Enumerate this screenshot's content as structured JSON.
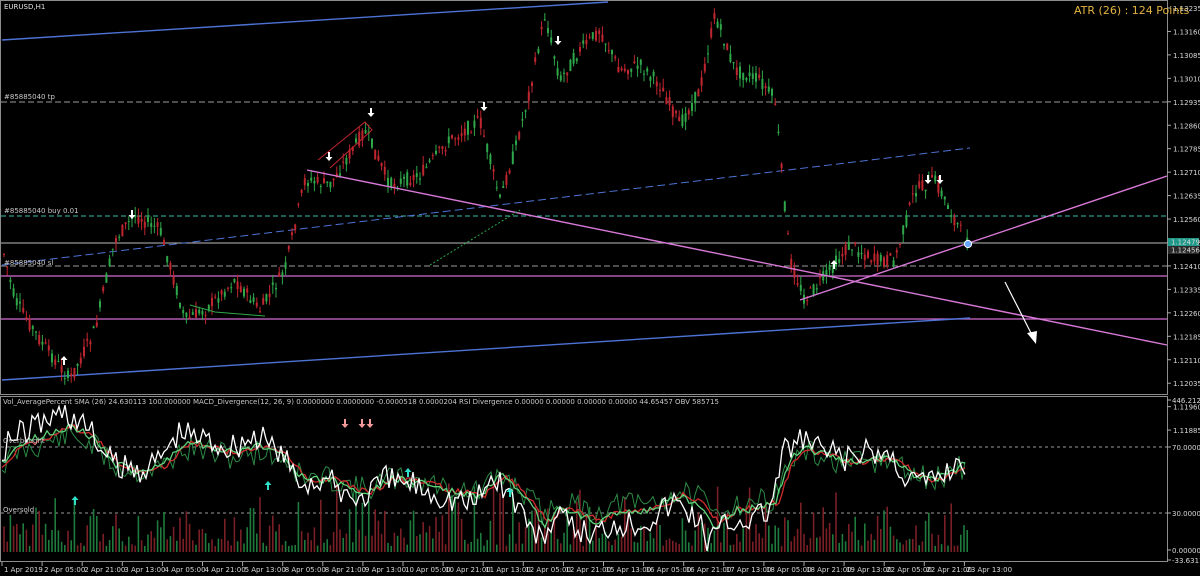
{
  "window": {
    "symbol_title": "EURUSD,H1",
    "atr_label": "ATR (26) : 124 Points"
  },
  "main_panel": {
    "line_labels": {
      "tp": "#85885040 tp",
      "buy": "#85885040 buy 0.01",
      "sl": "#85885040 sl"
    },
    "price_ticks": [
      "1.13235",
      "1.13160",
      "1.13085",
      "1.13010",
      "1.12935",
      "1.12860",
      "1.12785",
      "1.12710",
      "1.12635",
      "1.12560",
      "1.12485",
      "1.12410",
      "1.12335",
      "1.12260",
      "1.12185",
      "1.12110",
      "1.12035",
      "1.11960",
      "1.11885"
    ],
    "price_highlight": [
      "1.12479",
      "1.12456"
    ]
  },
  "indicator_panel": {
    "title": "Vol_AveragePercent SMA (26) 24.630113 100.000000 MACD_Divergence(12, 26, 9) 0.0000000 0.0000000 -0.0000518 0.0000204 RSI Divergence 0.00000 0.00000 0.00000 0.00000 44.65457 OBV 585715",
    "overbought_label": "Overbought",
    "oversold_label": "Oversold",
    "ticks": [
      "446.212757",
      "70.00000",
      "30.00000",
      "0.000000",
      "-33.631130"
    ]
  },
  "time_axis": {
    "labels": [
      "1 Apr 2019",
      "2 Apr 05:00",
      "2 Apr 21:00",
      "3 Apr 13:00",
      "4 Apr 05:00",
      "4 Apr 21:00",
      "5 Apr 13:00",
      "8 Apr 05:00",
      "8 Apr 21:00",
      "9 Apr 13:00",
      "10 Apr 05:00",
      "10 Apr 21:00",
      "11 Apr 13:00",
      "12 Apr 05:00",
      "12 Apr 21:00",
      "15 Apr 13:00",
      "16 Apr 05:00",
      "16 Apr 21:00",
      "17 Apr 13:00",
      "18 Apr 05:00",
      "18 Apr 21:00",
      "19 Apr 13:00",
      "22 Apr 05:00",
      "22 Apr 21:00",
      "23 Apr 13:00"
    ]
  },
  "colors": {
    "candle_up": "#2fa84a",
    "candle_down": "#c0262f",
    "channel_line": "#4e73d6",
    "trend_line": "#d879d8",
    "h_line": "#d26ed2",
    "grid_dash": "#9a9a9a",
    "osc_green_light": "#5fd27a",
    "osc_red": "#d02b2b",
    "osc_white": "#ffffff",
    "arrow_signal_down": "#ffffff",
    "arrow_signal_up_cyan": "#2ee0c8",
    "arrow_signal_down_pink": "#f29a9a"
  }
}
